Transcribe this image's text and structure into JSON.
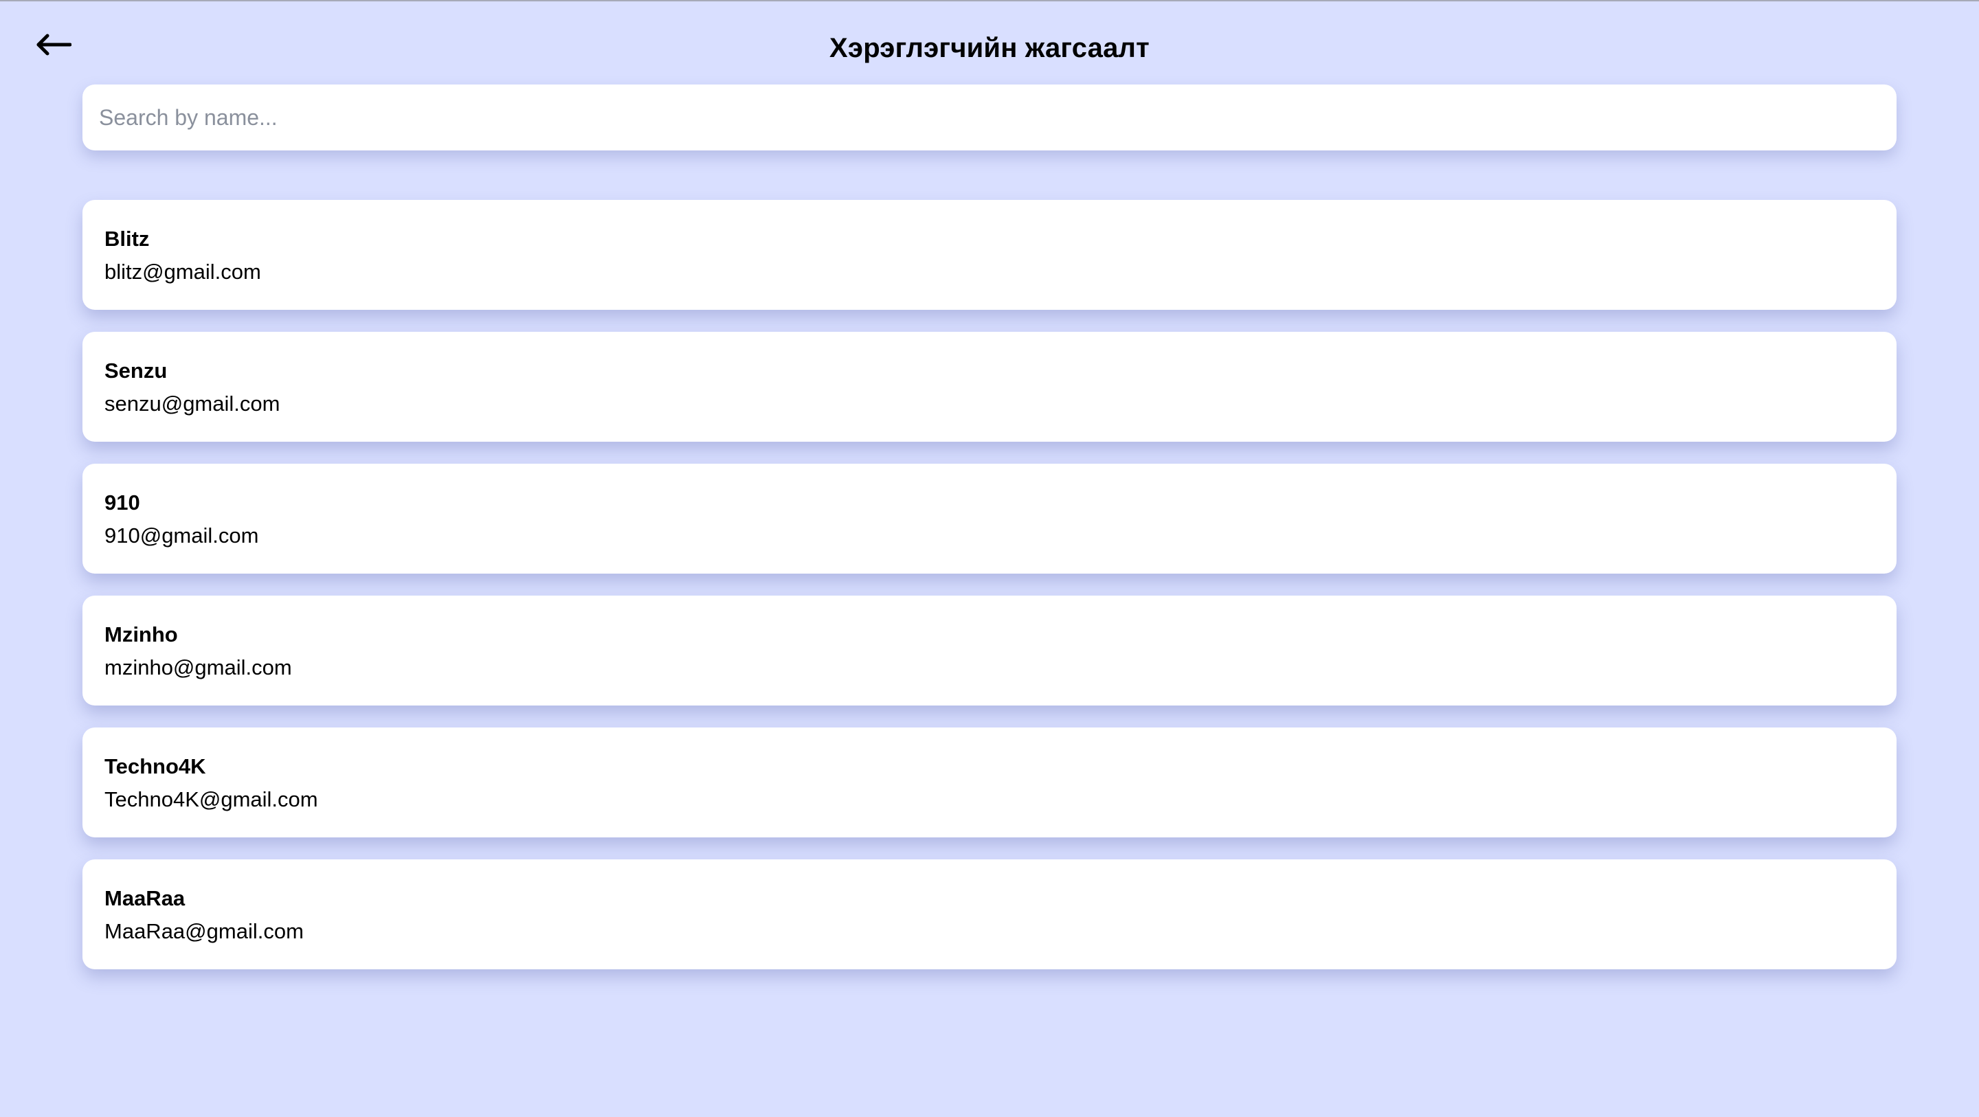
{
  "header": {
    "title": "Хэрэглэгчийн жагсаалт",
    "back_icon": "arrow-left-icon"
  },
  "search": {
    "placeholder": "Search by name...",
    "value": ""
  },
  "users": [
    {
      "name": "Blitz",
      "email": "blitz@gmail.com"
    },
    {
      "name": "Senzu",
      "email": "senzu@gmail.com"
    },
    {
      "name": "910",
      "email": "910@gmail.com"
    },
    {
      "name": "Mzinho",
      "email": "mzinho@gmail.com"
    },
    {
      "name": "Techno4K",
      "email": "Techno4K@gmail.com"
    },
    {
      "name": "MaaRaa",
      "email": "MaaRaa@gmail.com"
    }
  ],
  "colors": {
    "background": "#d9dfff",
    "card": "#ffffff",
    "text": "#000000",
    "placeholder": "#8a909c"
  }
}
